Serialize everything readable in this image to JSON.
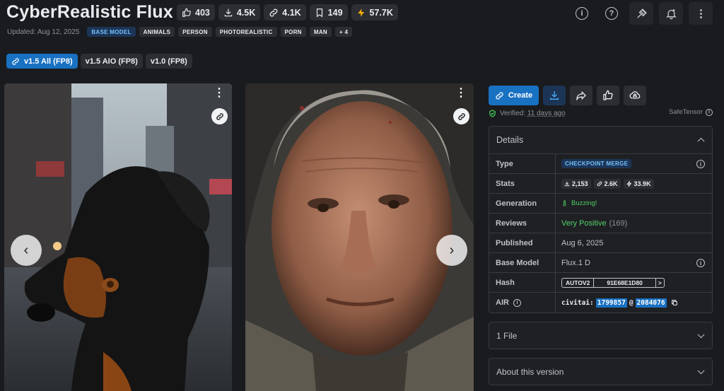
{
  "header": {
    "title": "CyberRealistic Flux",
    "stats": {
      "likes": "403",
      "downloads": "4.5K",
      "links": "4.1K",
      "bookmarks": "149",
      "buzz": "57.7K"
    },
    "updated": "Updated: Aug 12, 2025",
    "base_tag": "BASE MODEL",
    "tags": [
      "ANIMALS",
      "PERSON",
      "PHOTOREALISTIC",
      "PORN",
      "MAN",
      "+ 4"
    ]
  },
  "versions": [
    {
      "label": "v1.5 All (FP8)",
      "active": true
    },
    {
      "label": "v1.5 AIO (FP8)",
      "active": false
    },
    {
      "label": "v1.0 (FP8)",
      "active": false
    }
  ],
  "gallery": {
    "images": [
      {
        "subject": "black and tan dog in rainy city street"
      },
      {
        "subject": "portrait of elderly man"
      }
    ],
    "menu_glyph": "⋮",
    "prev_glyph": "‹",
    "next_glyph": "›"
  },
  "actions": {
    "create_label": "Create"
  },
  "verified": {
    "prefix": "Verified:",
    "time": "11 days ago",
    "format": "SafeTensor"
  },
  "details": {
    "heading": "Details",
    "type_label": "Type",
    "type_value": "CHECKPOINT MERGE",
    "stats_label": "Stats",
    "stat_downloads": "2,153",
    "stat_links": "2.6K",
    "stat_buzz": "33.9K",
    "generation_label": "Generation",
    "generation_value": "Buzzing!",
    "reviews_label": "Reviews",
    "reviews_value": "Very Positive",
    "reviews_count": "(169)",
    "published_label": "Published",
    "published_value": "Aug 6, 2025",
    "base_model_label": "Base Model",
    "base_model_value": "Flux.1 D",
    "hash_label": "Hash",
    "hash_type": "AUTOV2",
    "hash_value": "91E68E1D80",
    "hash_more": ">",
    "air_label": "AIR",
    "air_prefix": "civitai:",
    "air_model": "1799857",
    "air_at": "@",
    "air_version": "2084076"
  },
  "accordions": {
    "files": "1 File",
    "about": "About this version"
  },
  "colors": {
    "accent": "#1971c2",
    "background": "#1a1b1e",
    "positive": "#51cf66",
    "buzz": "#fab005"
  }
}
